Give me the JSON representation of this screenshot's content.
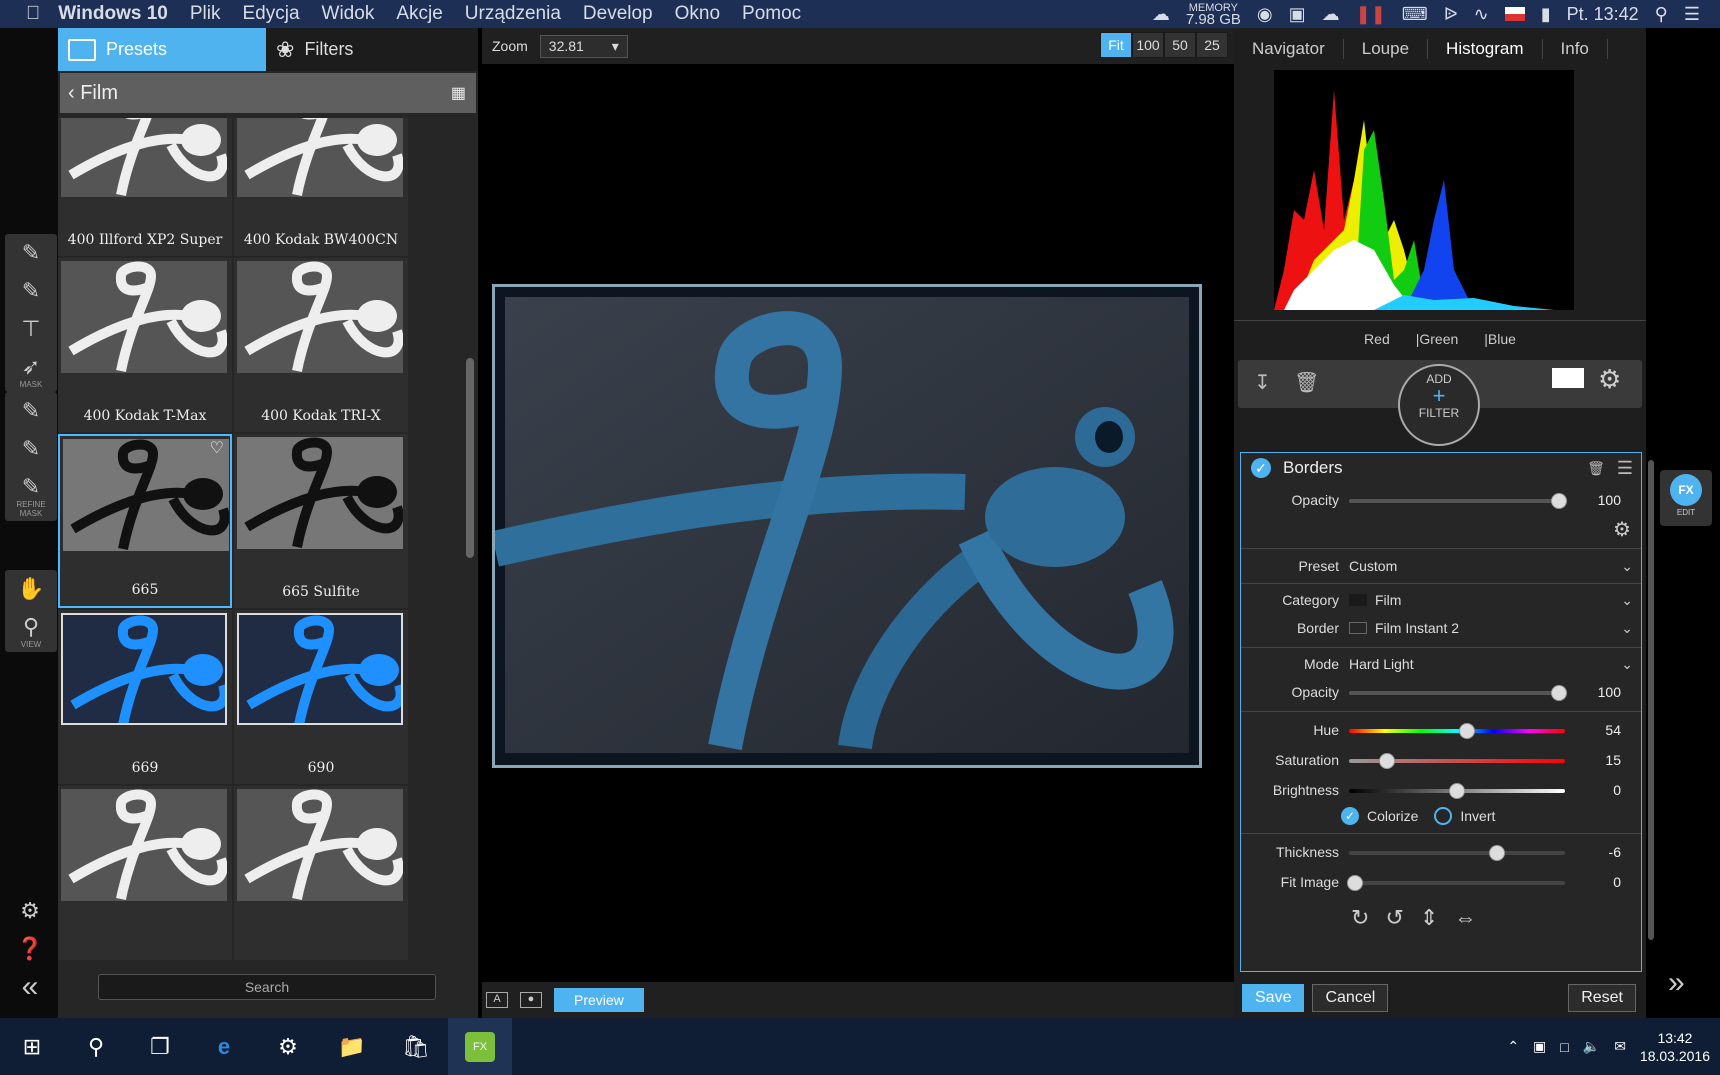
{
  "menubar": {
    "app_name": "Windows 10",
    "menus": [
      "Plik",
      "Edycja",
      "Widok",
      "Akcje",
      "Urządzenia",
      "Develop",
      "Okno",
      "Pomoc"
    ],
    "memory_label": "MEMORY",
    "memory_value": "7.98 GB",
    "clock": "Pt. 13:42"
  },
  "tools": {
    "mask_label": "MASK",
    "refine_label": "REFINE MASK",
    "view_label": "VIEW"
  },
  "presets": {
    "tab_presets": "Presets",
    "tab_filters": "Filters",
    "breadcrumb": "Film",
    "items": [
      {
        "label": "400 Illford XP2 Super",
        "style": "bw"
      },
      {
        "label": "400 Kodak BW400CN",
        "style": "bw"
      },
      {
        "label": "400 Kodak T-Max",
        "style": "bw"
      },
      {
        "label": "400 Kodak TRI-X",
        "style": "bw"
      },
      {
        "label": "665",
        "style": "dark"
      },
      {
        "label": "665 Sulfite",
        "style": "dark"
      },
      {
        "label": "669",
        "style": "blue"
      },
      {
        "label": "690",
        "style": "blue"
      },
      {
        "label": "",
        "style": "bw"
      },
      {
        "label": "",
        "style": "bw"
      }
    ],
    "search_placeholder": "Search"
  },
  "center": {
    "zoom_label": "Zoom",
    "zoom_value": "32.81",
    "zoom_buttons": [
      "Fit",
      "100",
      "50",
      "25"
    ],
    "preview_label": "Preview"
  },
  "right": {
    "tabs": [
      "Navigator",
      "Loupe",
      "Histogram",
      "Info"
    ],
    "channels": [
      "Red",
      "|Green",
      "|Blue"
    ],
    "add_filter_top": "ADD",
    "add_filter_bottom": "FILTER",
    "filter_name": "Borders",
    "rows": {
      "opacity1_label": "Opacity",
      "opacity1_value": "100",
      "preset_label": "Preset",
      "preset_value": "Custom",
      "category_label": "Category",
      "category_value": "Film",
      "border_label": "Border",
      "border_value": "Film Instant 2",
      "mode_label": "Mode",
      "mode_value": "Hard Light",
      "opacity2_label": "Opacity",
      "opacity2_value": "100",
      "hue_label": "Hue",
      "hue_value": "54",
      "sat_label": "Saturation",
      "sat_value": "15",
      "bright_label": "Brightness",
      "bright_value": "0",
      "colorize_label": "Colorize",
      "invert_label": "Invert",
      "thick_label": "Thickness",
      "thick_value": "-6",
      "fit_label": "Fit Image",
      "fit_value": "0"
    },
    "save": "Save",
    "cancel": "Cancel",
    "reset": "Reset",
    "edit_label": "EDIT"
  },
  "taskbar": {
    "time": "13:42",
    "date": "18.03.2016"
  }
}
